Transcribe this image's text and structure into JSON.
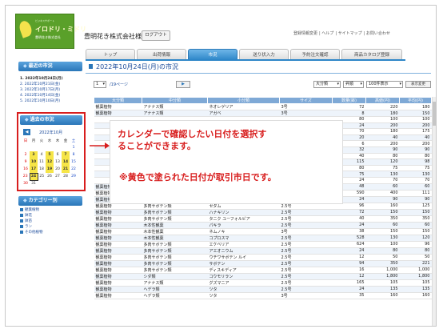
{
  "logo": {
    "line1": "ビジネスサポート",
    "line2": "イロドリ・ミドリ",
    "line3": "豊明花き株式会社"
  },
  "header": {
    "company": "豊明花き株式会社様",
    "logout": "ログアウト",
    "links": [
      "登録情報変更",
      "ヘルプ",
      "サイトマップ",
      "お問い合わせ"
    ]
  },
  "tabs": [
    "トップ",
    "出荷情報",
    "市況",
    "送り状入力",
    "予約注文確認",
    "商品カタログ登録"
  ],
  "main": {
    "title": "2022年10月24日(月)の市況"
  },
  "pager": {
    "page": "1",
    "of": "/19ページ",
    "next": "▶",
    "sort1": "大分類",
    "sort2": "昇順",
    "perpage": "100件表示",
    "sortbtn": "表示変更"
  },
  "recent": {
    "title": "最近の市況",
    "items": [
      "1. 2022年10月24日(月)",
      "2. 2022年10月21日(金)",
      "3. 2022年10月17日(月)",
      "4. 2022年10月14日(金)",
      "5. 2022年10月10日(月)"
    ]
  },
  "calendar": {
    "title": "過去の市況",
    "month": "2022年10月",
    "weekdays": [
      "日",
      "月",
      "火",
      "水",
      "木",
      "金",
      "土"
    ],
    "weeks": [
      [
        "",
        "",
        "",
        "",
        "",
        "",
        "1"
      ],
      [
        "2",
        "3",
        "4",
        "5",
        "6",
        "7",
        "8"
      ],
      [
        "9",
        "10",
        "11",
        "12",
        "13",
        "14",
        "15"
      ],
      [
        "16",
        "17",
        "18",
        "19",
        "20",
        "21",
        "22"
      ],
      [
        "23",
        "24",
        "25",
        "26",
        "27",
        "28",
        "29"
      ],
      [
        "30",
        "31",
        "",
        "",
        "",
        "",
        ""
      ]
    ],
    "market_days": [
      "3",
      "5",
      "7",
      "10",
      "12",
      "14",
      "17",
      "19",
      "21",
      "24"
    ],
    "selected": "24"
  },
  "categories": {
    "title": "カテゴリー別",
    "items": [
      "観葉植物",
      "鉢花",
      "鉢苗",
      "ラン",
      "その他植物"
    ]
  },
  "table": {
    "headers": [
      "大分類",
      "中分類",
      "小分類",
      "サイズ",
      "数量(鉢)",
      "高値(円)",
      "平均(円)"
    ],
    "rows": [
      [
        "観葉植物",
        "アナナス類",
        "ネオレゲリア",
        "3号",
        "72",
        "220",
        "180"
      ],
      [
        "観葉植物",
        "アナナス類",
        "アガベ",
        "3号",
        "8",
        "180",
        "150"
      ],
      [
        "",
        "",
        "",
        "",
        "80",
        "100",
        "100"
      ],
      [
        "",
        "",
        "",
        "",
        "24",
        "200",
        "200"
      ],
      [
        "",
        "",
        "",
        "",
        "70",
        "180",
        "175"
      ],
      [
        "",
        "",
        "",
        "",
        "20",
        "40",
        "40"
      ],
      [
        "",
        "",
        "",
        "",
        "6",
        "200",
        "200"
      ],
      [
        "",
        "",
        "",
        "",
        "32",
        "90",
        "90"
      ],
      [
        "",
        "",
        "",
        "",
        "40",
        "80",
        "80"
      ],
      [
        "",
        "",
        "",
        "",
        "115",
        "120",
        "98"
      ],
      [
        "",
        "",
        "",
        "",
        "80",
        "75",
        "75"
      ],
      [
        "",
        "",
        "",
        "",
        "75",
        "130",
        "130"
      ],
      [
        "",
        "",
        "",
        "",
        "24",
        "70",
        "70"
      ],
      [
        "観葉植物",
        "多肉サボテン類",
        "セダキイラ",
        "2.5号",
        "48",
        "60",
        "60"
      ],
      [
        "観葉植物",
        "多肉サボテン類",
        "タニクショクブツ",
        "2.5号",
        "590",
        "400",
        "111"
      ],
      [
        "観葉植物",
        "多肉サボテン類",
        "ボーチュラカリア",
        "2.5号",
        "24",
        "90",
        "90"
      ],
      [
        "観葉植物",
        "多肉サボテン類",
        "セダム",
        "2.5号",
        "96",
        "160",
        "125"
      ],
      [
        "観葉植物",
        "多肉サボテン類",
        "ハナキリン",
        "2.5号",
        "72",
        "150",
        "150"
      ],
      [
        "観葉植物",
        "多肉サボテン類",
        "タニク ユーフォルビア",
        "2.5号",
        "40",
        "350",
        "350"
      ],
      [
        "観葉植物",
        "木本性観葉",
        "パキラ",
        "2.5号",
        "24",
        "60",
        "60"
      ],
      [
        "観葉植物",
        "木本性観葉",
        "ネムノキ",
        "3号",
        "38",
        "150",
        "150"
      ],
      [
        "観葉植物",
        "木本性観葉",
        "コプロスマ",
        "2.5号",
        "528",
        "130",
        "120"
      ],
      [
        "観葉植物",
        "多肉サボテン類",
        "エケベリア",
        "2.5号",
        "624",
        "100",
        "96"
      ],
      [
        "観葉植物",
        "多肉サボテン類",
        "アエオニウム",
        "2.5号",
        "24",
        "80",
        "80"
      ],
      [
        "観葉植物",
        "多肉サボテン類",
        "ウチワサボテン ルイ",
        "2.5号",
        "12",
        "50",
        "50"
      ],
      [
        "観葉植物",
        "多肉サボテン類",
        "サボテン",
        "2.5号",
        "94",
        "350",
        "221"
      ],
      [
        "観葉植物",
        "多肉サボテン類",
        "ディスキディア",
        "2.5号",
        "16",
        "1,000",
        "1,000"
      ],
      [
        "観葉植物",
        "シダ類",
        "コウモリラン",
        "2.5号",
        "12",
        "1,800",
        "1,800"
      ],
      [
        "観葉植物",
        "アナナス類",
        "グズマニア",
        "2.5号",
        "165",
        "105",
        "105"
      ],
      [
        "観葉植物",
        "ヘデラ類",
        "ツタ",
        "2.5号",
        "24",
        "135",
        "135"
      ],
      [
        "観葉植物",
        "ヘデラ類",
        "ツタ",
        "3号",
        "35",
        "160",
        "160"
      ]
    ]
  },
  "annotation": {
    "line1": "カレンダーで確認したい日付を選択す",
    "line2": "ることができます。",
    "line3": "※黄色で塗られた日付が取引市日です。"
  },
  "colors": {
    "accent": "#2e86c8",
    "highlight": "#f6e547",
    "note": "#d81e1e",
    "header_row": "#7fa9d6"
  }
}
